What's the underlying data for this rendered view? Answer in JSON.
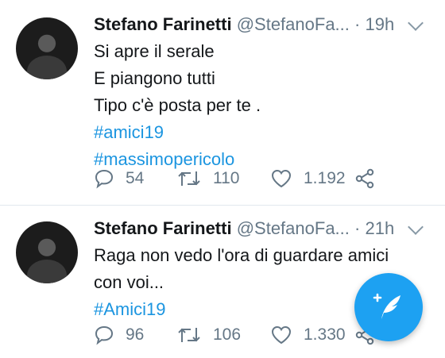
{
  "tweets": [
    {
      "name": "Stefano Farinetti",
      "handle": "@StefanoFa...",
      "dot": "·",
      "time": "19h",
      "lines": [
        "Si apre il serale",
        "E piangono tutti",
        "Tipo c'è posta per te ."
      ],
      "hashtags": [
        "#amici19",
        "#massimopericolo"
      ],
      "replies": "54",
      "retweets": "110",
      "likes": "1.192"
    },
    {
      "name": "Stefano Farinetti",
      "handle": "@StefanoFa...",
      "dot": "·",
      "time": "21h",
      "lines": [
        "Raga non vedo l'ora di guardare amici",
        "con voi..."
      ],
      "hashtags": [
        "#Amici19"
      ],
      "replies": "96",
      "retweets": "106",
      "likes": "1.330"
    }
  ],
  "icons": {
    "reply": "reply-icon",
    "retweet": "retweet-icon",
    "like": "heart-icon",
    "share": "share-icon",
    "more": "chevron-down-icon",
    "compose": "compose-tweet-icon"
  },
  "colors": {
    "accent": "#1da1f2",
    "hashtag": "#1b95e0",
    "secondary_text": "#657786"
  }
}
